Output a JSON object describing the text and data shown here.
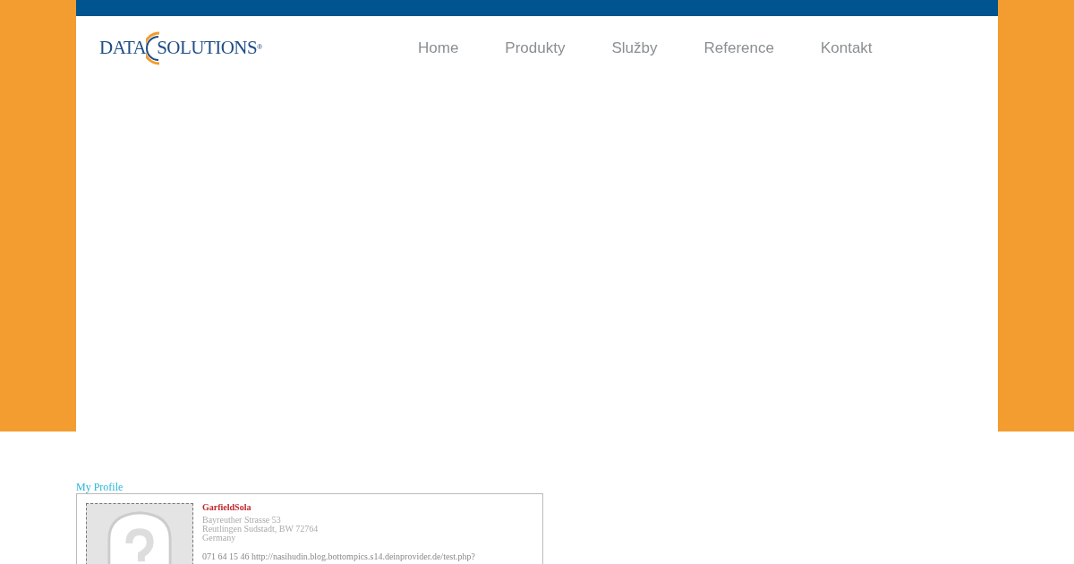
{
  "logo": {
    "left": "DATA",
    "right": "SOLUTIONS",
    "mark": "®"
  },
  "nav": [
    {
      "label": "Home"
    },
    {
      "label": "Produkty"
    },
    {
      "label": "Služby"
    },
    {
      "label": "Reference"
    },
    {
      "label": "Kontakt"
    }
  ],
  "profile": {
    "heading": "My Profile",
    "name": "GarfieldSola",
    "address": [
      "Bayreuther Strasse 53",
      "Reutlingen Sudstadt, BW 72764",
      "Germany"
    ],
    "contact": "071 64 15 46 http://nasihudin.blog.bottompics.s14.deinprovider.de/test.php?"
  }
}
